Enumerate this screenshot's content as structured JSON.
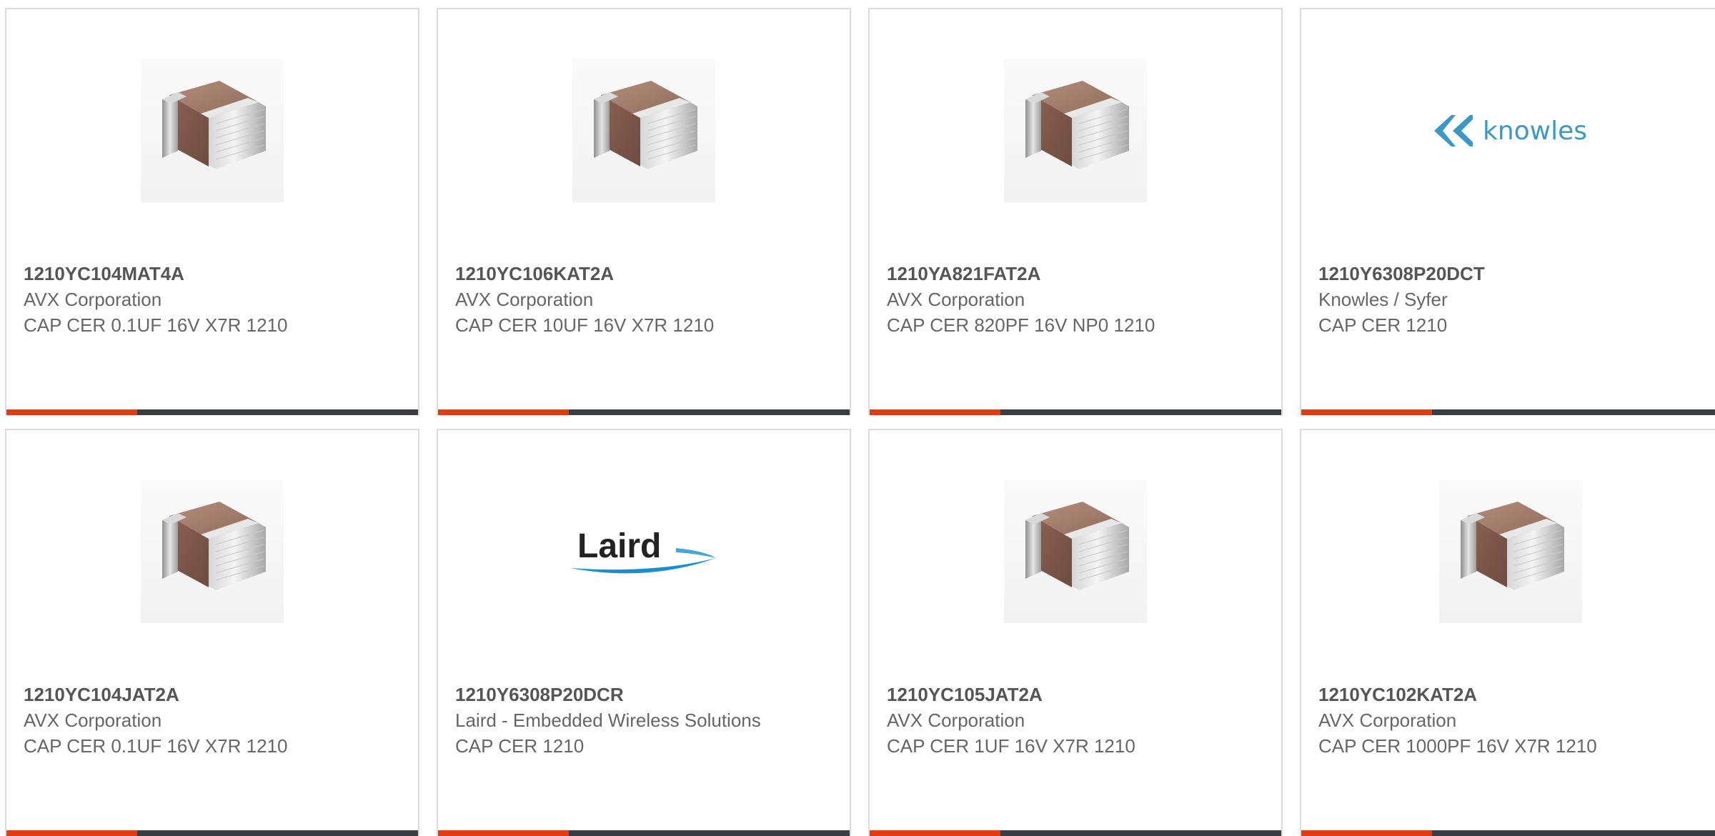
{
  "products": [
    {
      "part_number": "1210YC104MAT4A",
      "manufacturer": "AVX Corporation",
      "description": "CAP CER 0.1UF 16V X7R 1210",
      "image": "ceramic-capacitor"
    },
    {
      "part_number": "1210YC106KAT2A",
      "manufacturer": "AVX Corporation",
      "description": "CAP CER 10UF 16V X7R 1210",
      "image": "ceramic-capacitor"
    },
    {
      "part_number": "1210YA821FAT2A",
      "manufacturer": "AVX Corporation",
      "description": "CAP CER 820PF 16V NP0 1210",
      "image": "ceramic-capacitor"
    },
    {
      "part_number": "1210Y6308P20DCT",
      "manufacturer": "Knowles / Syfer",
      "description": "CAP CER 1210",
      "image": "knowles-logo",
      "logo_text": "knowles"
    },
    {
      "part_number": "1210YC104JAT2A",
      "manufacturer": "AVX Corporation",
      "description": "CAP CER 0.1UF 16V X7R 1210",
      "image": "ceramic-capacitor"
    },
    {
      "part_number": "1210Y6308P20DCR",
      "manufacturer": "Laird - Embedded Wireless Solutions",
      "description": "CAP CER 1210",
      "image": "laird-logo",
      "logo_text": "Laird"
    },
    {
      "part_number": "1210YC105JAT2A",
      "manufacturer": "AVX Corporation",
      "description": "CAP CER 1UF 16V X7R 1210",
      "image": "ceramic-capacitor"
    },
    {
      "part_number": "1210YC102KAT2A",
      "manufacturer": "AVX Corporation",
      "description": "CAP CER 1000PF 16V X7R 1210",
      "image": "ceramic-capacitor"
    }
  ],
  "colors": {
    "accent": "#e43c12",
    "bar": "#3a3d42",
    "text": "#666666",
    "border": "#dcdcdc",
    "knowles_blue": "#3c98c8",
    "laird_blue": "#1a8fd0"
  }
}
